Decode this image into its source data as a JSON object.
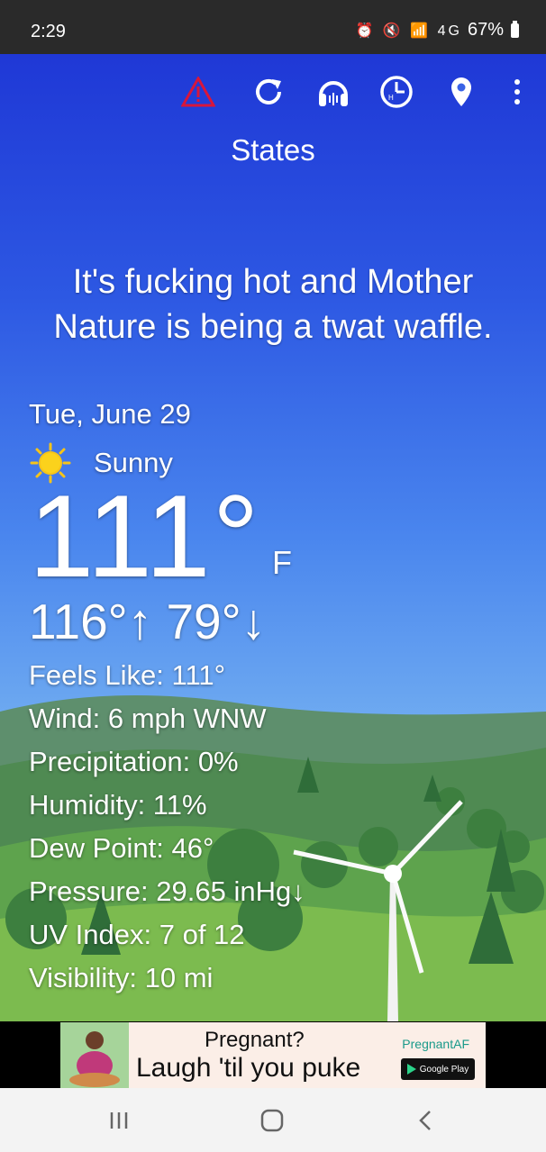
{
  "status_bar": {
    "time": "2:29",
    "icons": "⏰ 🔇 📶 4G",
    "battery": "67%"
  },
  "toolbar": {
    "icons": [
      "warning-icon",
      "refresh-icon",
      "headphones-icon",
      "history-icon",
      "location-pin-icon",
      "more-vert-icon"
    ],
    "alert_color": "#d8163b"
  },
  "weather": {
    "location": "States",
    "tagline": "It's fucking hot and Mother Nature is being a twat waffle.",
    "date": "Tue, June 29",
    "condition": "Sunny",
    "condition_icon": "sun-icon",
    "temperature": "111°",
    "unit": "F",
    "high": "116°↑",
    "low": "79°↓",
    "details": [
      "Feels Like: 111°",
      "Wind: 6 mph WNW",
      "Precipitation: 0%",
      "Humidity: 11%",
      "Dew Point: 46°",
      "Pressure: 29.65 inHg↓",
      "UV Index: 7 of 12",
      "Visibility: 10 mi"
    ]
  },
  "ad": {
    "line1": "Pregnant?",
    "line2": "Laugh 'til you puke",
    "brand": "PregnantAF",
    "store_badge": "Google Play"
  },
  "nav_bar": {
    "buttons": [
      "recent-apps-icon",
      "home-icon",
      "back-icon"
    ]
  }
}
